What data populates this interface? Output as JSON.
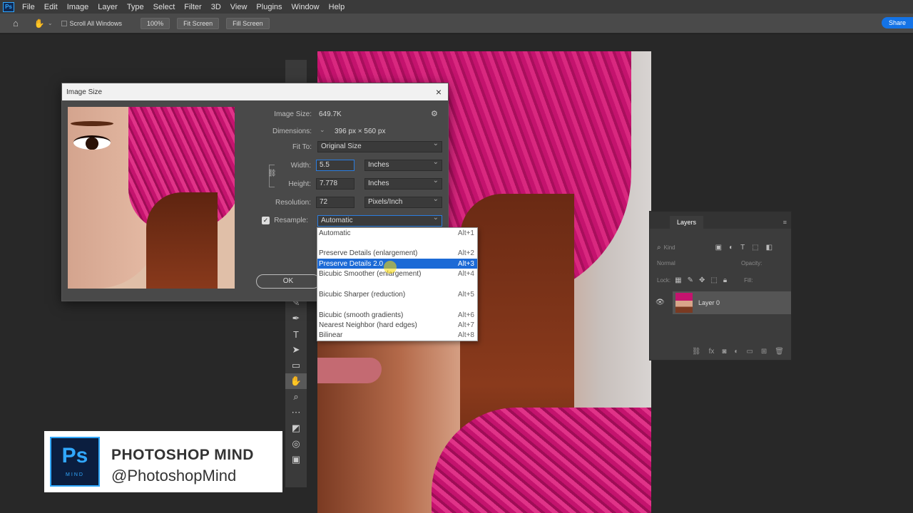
{
  "menubar": {
    "logo": "Ps",
    "items": [
      "File",
      "Edit",
      "Image",
      "Layer",
      "Type",
      "Select",
      "Filter",
      "3D",
      "View",
      "Plugins",
      "Window",
      "Help"
    ]
  },
  "options": {
    "scroll_all": "Scroll All Windows",
    "zoom": "100%",
    "fit_screen": "Fit Screen",
    "fill_screen": "Fill Screen",
    "share": "Share"
  },
  "dialog": {
    "title": "Image Size",
    "image_size_label": "Image Size:",
    "image_size_value": "649.7K",
    "dimensions_label": "Dimensions:",
    "dimensions_value": "396 px  ×  560 px",
    "fit_to_label": "Fit To:",
    "fit_to_value": "Original Size",
    "width_label": "Width:",
    "width_value": "5.5",
    "width_unit": "Inches",
    "height_label": "Height:",
    "height_value": "7.778",
    "height_unit": "Inches",
    "resolution_label": "Resolution:",
    "resolution_value": "72",
    "resolution_unit": "Pixels/Inch",
    "resample_label": "Resample:",
    "resample_value": "Automatic",
    "resample_checked": true,
    "ok_label": "OK"
  },
  "resample_menu": [
    {
      "label": "Automatic",
      "shortcut": "Alt+1"
    },
    {
      "label": "Preserve Details (enlargement)",
      "shortcut": "Alt+2"
    },
    {
      "label": "Preserve Details 2.0",
      "shortcut": "Alt+3",
      "selected": true
    },
    {
      "label": "Bicubic Smoother (enlargement)",
      "shortcut": "Alt+4"
    },
    {
      "label": "Bicubic Sharper (reduction)",
      "shortcut": "Alt+5"
    },
    {
      "label": "Bicubic (smooth gradients)",
      "shortcut": "Alt+6"
    },
    {
      "label": "Nearest Neighbor (hard edges)",
      "shortcut": "Alt+7"
    },
    {
      "label": "Bilinear",
      "shortcut": "Alt+8"
    }
  ],
  "layers": {
    "tab": "Layers",
    "search_placeholder": "Kind",
    "blend_mode": "Normal",
    "opacity_label": "Opacity:",
    "lock_label": "Lock:",
    "fill_label": "Fill:",
    "layer_name": "Layer 0"
  },
  "brand": {
    "logo_text": "Ps",
    "logo_sub": "MIND",
    "name": "PHOTOSHOP MIND",
    "handle": "@PhotoshopMind"
  },
  "colors": {
    "accent": "#1473e6",
    "selection": "#1c6ad6",
    "panel": "#494949",
    "hat": "#c4136e"
  }
}
